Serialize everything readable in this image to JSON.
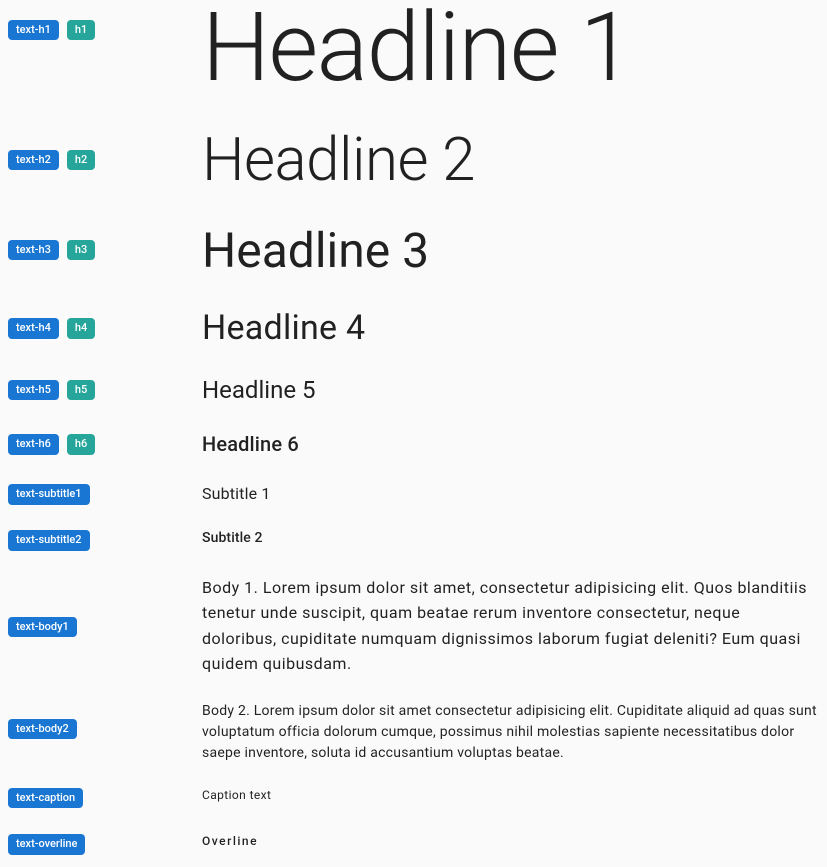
{
  "rows": [
    {
      "tagPrimary": "text-h1",
      "tagSecondary": "h1",
      "sample": "Headline 1"
    },
    {
      "tagPrimary": "text-h2",
      "tagSecondary": "h2",
      "sample": "Headline 2"
    },
    {
      "tagPrimary": "text-h3",
      "tagSecondary": "h3",
      "sample": "Headline 3"
    },
    {
      "tagPrimary": "text-h4",
      "tagSecondary": "h4",
      "sample": "Headline 4"
    },
    {
      "tagPrimary": "text-h5",
      "tagSecondary": "h5",
      "sample": "Headline 5"
    },
    {
      "tagPrimary": "text-h6",
      "tagSecondary": "h6",
      "sample": "Headline 6"
    },
    {
      "tagPrimary": "text-subtitle1",
      "tagSecondary": null,
      "sample": "Subtitle 1"
    },
    {
      "tagPrimary": "text-subtitle2",
      "tagSecondary": null,
      "sample": "Subtitle 2"
    },
    {
      "tagPrimary": "text-body1",
      "tagSecondary": null,
      "sample": "Body 1. Lorem ipsum dolor sit amet, consectetur adipisicing elit. Quos blanditiis tenetur unde suscipit, quam beatae rerum inventore consectetur, neque doloribus, cupiditate numquam dignissimos laborum fugiat deleniti? Eum quasi quidem quibusdam."
    },
    {
      "tagPrimary": "text-body2",
      "tagSecondary": null,
      "sample": "Body 2. Lorem ipsum dolor sit amet consectetur adipisicing elit. Cupiditate aliquid ad quas sunt voluptatum officia dolorum cumque, possimus nihil molestias sapiente necessitatibus dolor saepe inventore, soluta id accusantium voluptas beatae."
    },
    {
      "tagPrimary": "text-caption",
      "tagSecondary": null,
      "sample": "Caption text"
    },
    {
      "tagPrimary": "text-overline",
      "tagSecondary": null,
      "sample": "Overline"
    }
  ]
}
